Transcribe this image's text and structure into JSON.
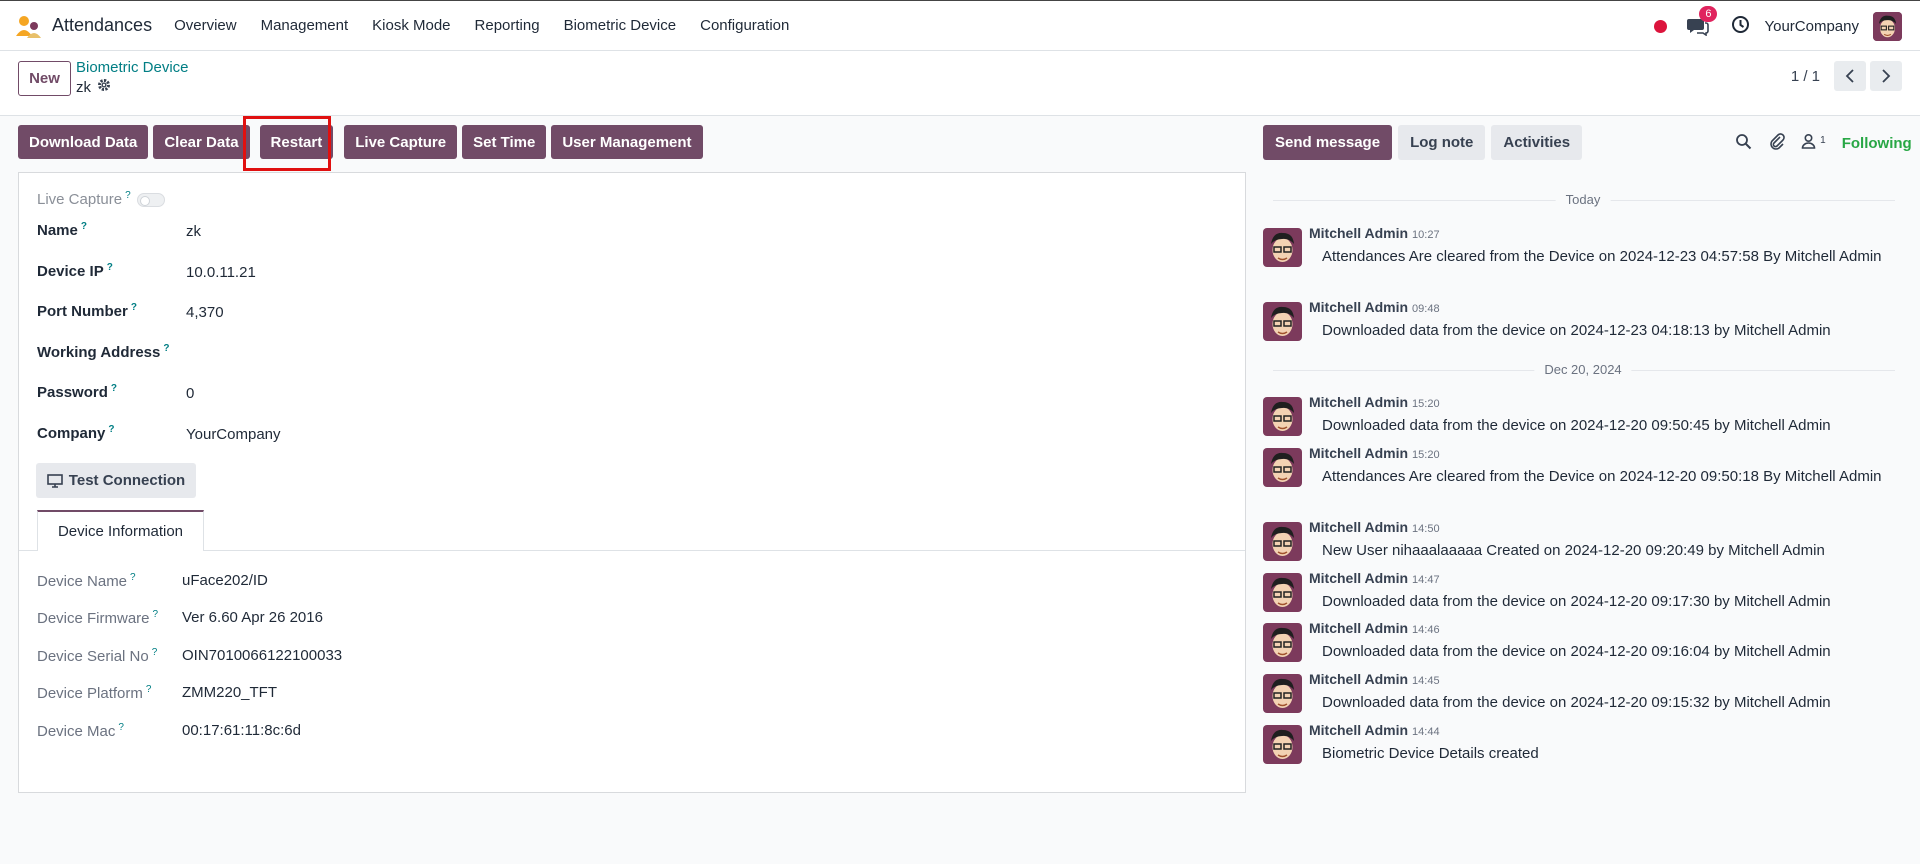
{
  "navbar": {
    "app_title": "Attendances",
    "menu": [
      "Overview",
      "Management",
      "Kiosk Mode",
      "Reporting",
      "Biometric Device",
      "Configuration"
    ],
    "notification_count": "6",
    "company": "YourCompany"
  },
  "control": {
    "new_label": "New",
    "breadcrumb": "Biometric Device",
    "record_name": "zk",
    "pager": "1 / 1"
  },
  "actions": {
    "download": "Download Data",
    "clear": "Clear Data",
    "restart": "Restart",
    "live": "Live Capture",
    "set_time": "Set Time",
    "user_mgmt": "User Management"
  },
  "form": {
    "live_capture_label": "Live Capture",
    "fields": [
      {
        "label": "Name",
        "value": "zk"
      },
      {
        "label": "Device IP",
        "value": "10.0.11.21"
      },
      {
        "label": "Port Number",
        "value": "4,370"
      },
      {
        "label": "Working Address",
        "value": ""
      },
      {
        "label": "Password",
        "value": "0"
      },
      {
        "label": "Company",
        "value": "YourCompany"
      }
    ],
    "test_connection": "Test Connection",
    "tab_label": "Device Information",
    "device_info": [
      {
        "label": "Device Name",
        "value": "uFace202/ID"
      },
      {
        "label": "Device Firmware",
        "value": "Ver 6.60 Apr 26 2016"
      },
      {
        "label": "Device Serial No",
        "value": "OIN7010066122100033"
      },
      {
        "label": "Device Platform",
        "value": "ZMM220_TFT"
      },
      {
        "label": "Device Mac",
        "value": "00:17:61:11:8c:6d"
      }
    ]
  },
  "chatter": {
    "send_message": "Send message",
    "log_note": "Log note",
    "activities": "Activities",
    "follower_count": "1",
    "following": "Following",
    "separators": [
      "Today",
      "Dec 20, 2024"
    ],
    "messages": [
      {
        "author": "Mitchell Admin",
        "time": "10:27",
        "body": "Attendances Are cleared from the Device on 2024-12-23 04:57:58 By Mitchell Admin"
      },
      {
        "author": "Mitchell Admin",
        "time": "09:48",
        "body": "Downloaded data from the device on 2024-12-23 04:18:13 by Mitchell Admin"
      },
      {
        "author": "Mitchell Admin",
        "time": "15:20",
        "body": "Downloaded data from the device on 2024-12-20 09:50:45 by Mitchell Admin"
      },
      {
        "author": "Mitchell Admin",
        "time": "15:20",
        "body": "Attendances Are cleared from the Device on 2024-12-20 09:50:18 By Mitchell Admin"
      },
      {
        "author": "Mitchell Admin",
        "time": "14:50",
        "body": "New User nihaaalaaaaa Created on 2024-12-20 09:20:49 by Mitchell Admin"
      },
      {
        "author": "Mitchell Admin",
        "time": "14:47",
        "body": "Downloaded data from the device on 2024-12-20 09:17:30 by Mitchell Admin"
      },
      {
        "author": "Mitchell Admin",
        "time": "14:46",
        "body": "Downloaded data from the device on 2024-12-20 09:16:04 by Mitchell Admin"
      },
      {
        "author": "Mitchell Admin",
        "time": "14:45",
        "body": "Downloaded data from the device on 2024-12-20 09:15:32 by Mitchell Admin"
      },
      {
        "author": "Mitchell Admin",
        "time": "14:44",
        "body": "Biometric Device Details created"
      }
    ]
  },
  "colors": {
    "brand": "#714b67",
    "link": "#017e84",
    "following": "#28a745",
    "highlight": "#e01010"
  }
}
